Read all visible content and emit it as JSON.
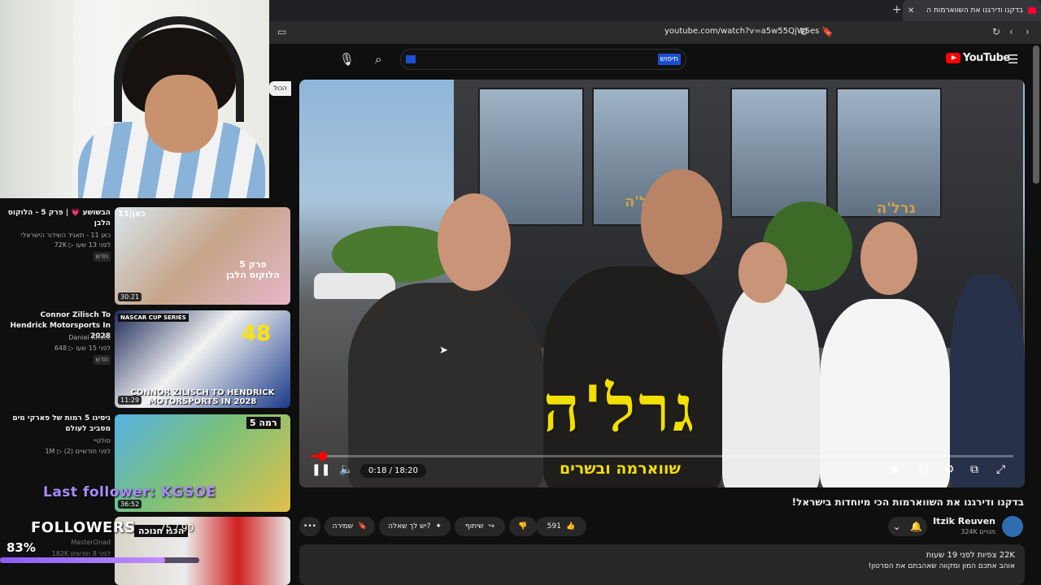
{
  "browser": {
    "tab_title": "בדקנו ודירגנו את השווארמות ה",
    "new_tab": "+",
    "tab_close": "✕",
    "url": "youtube.com/watch?v=a5w55QjW5es"
  },
  "header": {
    "brand": "YouTube",
    "search_button": "חיפוש",
    "menu_icon": "hamburger-icon"
  },
  "player": {
    "time": "0:18 / 18:20",
    "progress_fraction": 0.016,
    "overlay_logo": "גרל'ה",
    "overlay_subtitle": "שווארמה ובשרים",
    "sign_text": "גרל'ה"
  },
  "video": {
    "title": "בדקנו ודירגנו את השווארמות הכי מיוחדות בישראל!",
    "channel_name": "Itzik Reuven",
    "channel_subs": "324K מנויים",
    "like_count": "591",
    "share_label": "שיתוף",
    "ask_label": "יש לך שאלה?",
    "save_label": "שמירה",
    "more_label": "•••",
    "views_line": "22K צפיות  לפני 19 שעות",
    "description": "אוהב אתכם המון ומקווה שאהבתם את הסרטון!"
  },
  "chips": {
    "all_label": "הכול"
  },
  "recommendations": [
    {
      "title": "הבשושע 💗 | פרק 5 - הלוקוס הלבן",
      "channel": "כאן 11 - תאגיד השידור הישראלי",
      "meta": "72K ▷ לפני 13 שעו",
      "badge": "חדש",
      "duration": "30:21",
      "thumb_text": "פרק 5\nהלוקוס הלבן",
      "thumb_corner": "כאן|11"
    },
    {
      "title": "Connor Zilisch To Hendrick Motorsports In 2028",
      "channel": "Daniel Kriete",
      "meta": "648 ▷ לפני 15 שעו",
      "badge": "חדש",
      "duration": "11:29",
      "thumb_text": "CONNOR ZILISCH TO HENDRICK MOTORSPORTS IN 2028",
      "thumb_number": "48",
      "thumb_corner": "NASCAR CUP SERIES"
    },
    {
      "title": "ניסינו 5 רמות של פארקי מים מסביב לעולם",
      "channel": "סולטיי",
      "meta": "1M ▷ לפני חודשיים (2)",
      "duration": "36:52",
      "thumb_corner": "רמה 5"
    },
    {
      "title": "",
      "channel": "MasterOnad",
      "meta": "182K לפני 8 חודשים",
      "thumb_text": "הכנו חנוכה"
    }
  ],
  "stream_overlay": {
    "last_follower": "Last follower: KGSOE",
    "followers_label": "FOLLOWERS",
    "followers_count": "75 / 90",
    "followers_percent": "83%",
    "followers_fraction": 0.83
  },
  "colors": {
    "accent": "#ff0000",
    "search_highlight": "#1a4fcf",
    "goal_bar": "#8a5cf6"
  }
}
